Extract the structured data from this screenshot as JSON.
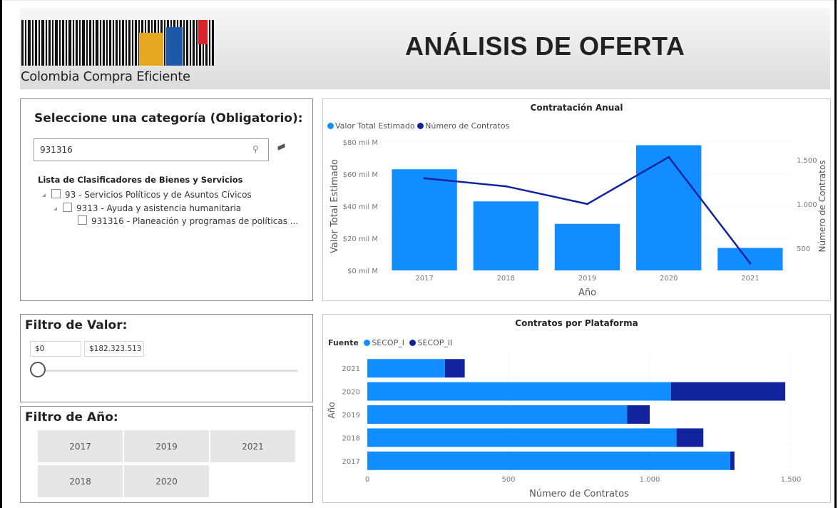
{
  "header": {
    "logo_text": "Colombia Compra Eficiente",
    "title": "ANÁLISIS DE OFERTA"
  },
  "category_panel": {
    "title": "Seleccione una categoría (Obligatorio):",
    "search_value": "931316",
    "tree_title": "Lista de Clasificadores de Bienes y Servicios",
    "tree": [
      {
        "label": "93 - Servicios Políticos y de Asuntos Cívicos",
        "level": 0,
        "expanded": true,
        "checked": false
      },
      {
        "label": "9313 - Ayuda y asistencia humanitaria",
        "level": 1,
        "expanded": true,
        "checked": false
      },
      {
        "label": "931316 - Planeación y programas de políticas ...",
        "level": 2,
        "expanded": false,
        "checked": false
      }
    ]
  },
  "value_filter": {
    "title": "Filtro de Valor:",
    "min": "$0",
    "max": "$182.323.513",
    "slider_position": 0
  },
  "year_filter": {
    "title": "Filtro de Año:",
    "years": [
      "2017",
      "2019",
      "2021",
      "2018",
      "2020"
    ]
  },
  "colors": {
    "light_blue": "#118dff",
    "dark_blue": "#12239e",
    "border": "#8a8a8a"
  },
  "chart_data": [
    {
      "type": "bar",
      "title": "Contratación Anual",
      "categories": [
        "2017",
        "2018",
        "2019",
        "2020",
        "2021"
      ],
      "series": [
        {
          "name": "Valor Total Estimado",
          "type": "bar",
          "axis": "left",
          "values": [
            63,
            43,
            29,
            78,
            14
          ],
          "color": "#118dff"
        },
        {
          "name": "Número de Contratos",
          "type": "line",
          "axis": "right",
          "values": [
            1290,
            1200,
            1000,
            1530,
            330
          ],
          "color": "#12239e"
        }
      ],
      "xlabel": "Año",
      "ylabel": "Valor Total Estimado",
      "y2label": "Número de Contratos",
      "ylim": [
        0,
        80
      ],
      "y_ticks": [
        "$0 mil M",
        "$20 mil M",
        "$40 mil M",
        "$60 mil M",
        "$80 mil M"
      ],
      "y2lim": [
        250,
        1700
      ],
      "y2_ticks": [
        {
          "value": 500,
          "label": "500"
        },
        {
          "value": 1000,
          "label": "1.000"
        },
        {
          "value": 1500,
          "label": "1.500"
        }
      ],
      "legend_position": "top-left",
      "grid": true
    },
    {
      "type": "bar",
      "orientation": "horizontal",
      "stacked": true,
      "title": "Contratos por Plataforma",
      "legend_title": "Fuente",
      "categories": [
        "2021",
        "2020",
        "2019",
        "2018",
        "2017"
      ],
      "series": [
        {
          "name": "SECOP_I",
          "values": [
            275,
            1075,
            920,
            1095,
            1285
          ],
          "color": "#118dff"
        },
        {
          "name": "SECOP_II",
          "values": [
            70,
            405,
            80,
            95,
            15
          ],
          "color": "#12239e"
        }
      ],
      "xlabel": "Número de Contratos",
      "ylabel": "Año",
      "xlim": [
        0,
        1500
      ],
      "x_ticks": [
        {
          "value": 0,
          "label": "0"
        },
        {
          "value": 500,
          "label": "500"
        },
        {
          "value": 1000,
          "label": "1.000"
        },
        {
          "value": 1500,
          "label": "1.500"
        }
      ],
      "legend_position": "top-left",
      "grid": true
    }
  ]
}
